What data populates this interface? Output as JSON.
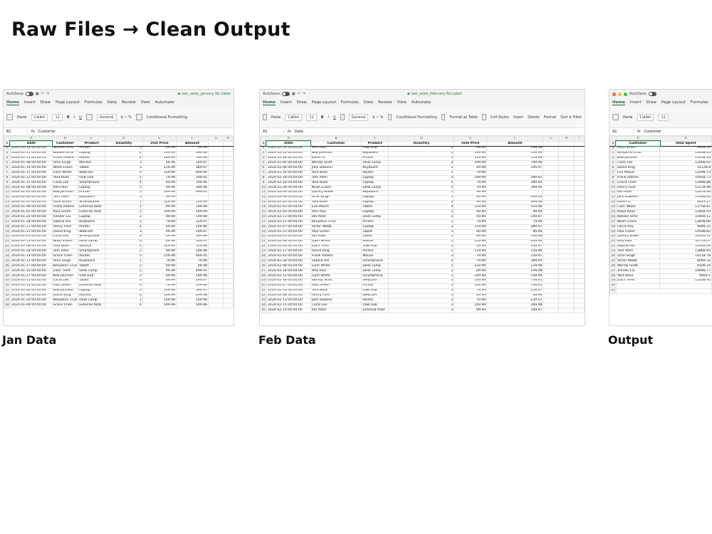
{
  "title": "Raw Files → Clean Output",
  "common": {
    "autosave": "AutoSave",
    "tabs": [
      "Home",
      "Insert",
      "Draw",
      "Page Layout",
      "Formulas",
      "Data",
      "Review",
      "View",
      "Automate"
    ],
    "font": "Calibri",
    "font_size": "11",
    "number_format": "General",
    "paste": "Paste",
    "cond_format": "Conditional Formatting",
    "format_table": "Format as Table",
    "cell_styles": "Cell Styles",
    "insert": "Insert",
    "delete": "Delete",
    "format": "Format",
    "sort_filter": "Sort & Filter",
    "fx": "fx",
    "no_label": "No Label"
  },
  "jan": {
    "caption": "Jan Data",
    "doc_name": "raw_sales_january",
    "cell_ref": "B1",
    "formula": "Customer",
    "col_letters": [
      "A",
      "B",
      "C",
      "D",
      "E",
      "F",
      "G",
      "H"
    ],
    "headers": [
      "Date",
      "Customer",
      "Product",
      "Quantity",
      "Unit Price",
      "Amount"
    ],
    "rows": [
      [
        "2024-01-14 00:00:00",
        "Natalie Ortiz",
        "Printer",
        "1",
        "49.99",
        "49.99"
      ],
      [
        "2024-01-21 00:00:00",
        "Natalie Ortiz",
        "Laptop",
        "4",
        "149.99",
        "599.96"
      ],
      [
        "2024-01-11 00:00:00",
        "Frank Adams",
        "Router",
        "4",
        "199.99",
        "799.96"
      ],
      [
        "2024-01-08 00:00:00",
        "Uma Singh",
        "Monitor",
        "3",
        "49.99",
        "149.97"
      ],
      [
        "2024-01-14 00:00:00",
        "Noah Evans",
        "Tablet",
        "3",
        "129.99",
        "389.97"
      ],
      [
        "2024-01-17 00:00:00",
        "Liam White",
        "Webcam",
        "5",
        "129.99",
        "649.95"
      ],
      [
        "2024-01-12 00:00:00",
        "Yara Bose",
        "USB Hub",
        "5",
        "79.99",
        "399.95"
      ],
      [
        "2024-01-15 00:00:00",
        "Carla Lee",
        "Smartphone",
        "4",
        "49.99",
        "199.96"
      ],
      [
        "2024-01-08 00:00:00",
        "Rita Paul",
        "Laptop",
        "5",
        "99.99",
        "399.96"
      ],
      [
        "2024-01-05 00:00:00",
        "Bob Johnson",
        "Printer",
        "5",
        "199.99",
        "999.95"
      ],
      [
        "2024-01-06 00:00:00",
        "Tom Allen",
        "Keyboard",
        "1",
        "99.99",
        ""
      ],
      [
        "2024-01-25 00:00:00",
        "Alice Smith",
        "Smartphone",
        "1",
        "129.99",
        "129.99"
      ],
      [
        "2024-01-09 00:00:00",
        "Frank Adams",
        "External HDD",
        "2",
        "99.99",
        "199.98"
      ],
      [
        "2024-01-03 00:00:00",
        "Paul Green",
        "External HDD",
        "1",
        "199.99",
        "199.99"
      ],
      [
        "2024-01-25 00:00:00",
        "Xander Liu",
        "Laptop",
        "2",
        "99.99",
        "199.98"
      ],
      [
        "2024-01-28 00:00:00",
        "Sophia Hill",
        "Keyboard",
        "3",
        "79.99",
        "239.97"
      ],
      [
        "2024-01-17 00:00:00",
        "Henry Ford",
        "Printer",
        "4",
        "49.99",
        "199.96"
      ],
      [
        "2024-01-21 00:00:00",
        "David King",
        "Webcam",
        "3",
        "99.99",
        "299.97"
      ],
      [
        "2024-01-23 00:00:00",
        "Carla Lee",
        "Smartphone",
        "4",
        "49.99",
        "199.96"
      ],
      [
        "2024-01-13 00:00:00",
        "Noah Evans",
        "Desk Lamp",
        "3",
        "49.99",
        "149.97"
      ],
      [
        "2024-01-08 00:00:00",
        "Yara Bose",
        "Monitor",
        "4",
        "129.99",
        "519.96"
      ],
      [
        "2024-01-28 00:00:00",
        "Tom Allen",
        "Smartphone",
        "2",
        "99.99",
        "199.98"
      ],
      [
        "2024-01-14 00:00:00",
        "Grace Chen",
        "Router",
        "5",
        "129.99",
        "649.95"
      ],
      [
        "2024-01-11 00:00:00",
        "Uma Singh",
        "Keyboard",
        "1",
        "79.99",
        "79.99"
      ],
      [
        "2024-01-27 00:00:00",
        "Benjamin Cruz",
        "Tablet",
        "2",
        "49.99",
        "99.98"
      ],
      [
        "2024-01-15 00:00:00",
        "Zach Trent",
        "Desk Lamp",
        "5",
        "99.99",
        "499.95"
      ],
      [
        "2024-01-27 00:00:00",
        "Bob Johnson",
        "USB Hub",
        "2",
        "99.99",
        "199.98"
      ],
      [
        "2024-01-11 00:00:00",
        "Carla Lee",
        "Tablet",
        "3",
        "99.99",
        "299.97"
      ],
      [
        "2024-01-14 00:00:00",
        "Paul Green",
        "External HDD",
        "4",
        "79.99",
        "319.96"
      ],
      [
        "2024-01-26 00:00:00",
        "Bob Johnson",
        "Laptop",
        "3",
        "199.99",
        "599.97"
      ],
      [
        "2024-01-28 00:00:00",
        "David King",
        "Monitor",
        "2",
        "149.99",
        "299.98"
      ],
      [
        "2024-01-20 00:00:00",
        "Benjamin Cruz",
        "Desk Lamp",
        "1",
        "149.99",
        "149.99"
      ],
      [
        "2024-01-09 00:00:00",
        "Grace Chen",
        "External HDD",
        "4",
        "149.99",
        "599.96"
      ]
    ]
  },
  "feb": {
    "caption": "Feb Data",
    "doc_name": "raw_sales_february",
    "cell_ref": "A1",
    "formula": "Date",
    "col_letters": [
      "A",
      "B",
      "C",
      "D",
      "E",
      "F",
      "G",
      "H",
      "I"
    ],
    "headers": [
      "Date",
      "Customer",
      "Product",
      "Quantity",
      "Unit Price",
      "Amount"
    ],
    "rows": [
      [
        "2024-02-19 00:00:00",
        "Rita Paul",
        "USB Hub",
        "2",
        "99.99",
        "199.98"
      ],
      [
        "2024-02-20 00:00:00",
        "Bob Johnson",
        "Keyboard",
        "1",
        "199.99",
        "199.99"
      ],
      [
        "2024-02-18 00:00:00",
        "Karen Li",
        "Printer",
        "4",
        "129.99",
        "519.96"
      ],
      [
        "2024-02-04 00:00:00",
        "Wendy Scott",
        "Desk Lamp",
        "4",
        "199.99",
        "799.96"
      ],
      [
        "2024-02-06 00:00:00",
        "Jack Dawson",
        "Keyboard",
        "3",
        "49.99",
        "149.97"
      ],
      [
        "2024-02-10 00:00:00",
        "Yara Bose",
        "Router",
        "1",
        "79.99",
        ""
      ],
      [
        "2024-02-18 00:00:00",
        "Tom Allen",
        "Laptop",
        "3",
        "199.99",
        "599.97"
      ],
      [
        "2024-02-20 00:00:00",
        "Yara Bose",
        "Laptop",
        "5",
        "79.99",
        "399.95"
      ],
      [
        "2024-02-28 00:00:00",
        "Noah Evans",
        "Desk Lamp",
        "5",
        "79.99",
        "399.95"
      ],
      [
        "2024-02-09 00:00:00",
        "Quincy Blake",
        "Keyboard",
        "1",
        "99.99",
        ""
      ],
      [
        "2024-02-06 00:00:00",
        "Uma Singh",
        "Laptop",
        "5",
        "99.99",
        "499.95"
      ],
      [
        "2024-02-20 00:00:00",
        "Yara Bose",
        "Laptop",
        "4",
        "99.99",
        "399.96"
      ],
      [
        "2024-02-03 00:00:00",
        "Eve Moore",
        "Tablet",
        "4",
        "129.99",
        "519.96"
      ],
      [
        "2024-02-03 00:00:00",
        "Rita Paul",
        "Laptop",
        "1",
        "99.99",
        "99.99"
      ],
      [
        "2024-02-11 00:00:00",
        "Ida Patel",
        "Desk Lamp",
        "3",
        "49.99",
        "149.97"
      ],
      [
        "2024-02-21 00:00:00",
        "Benjamin Cruz",
        "Printer",
        "1",
        "79.99",
        "79.99"
      ],
      [
        "2024-02-07 00:00:00",
        "Victor Webb",
        "Laptop",
        "3",
        "129.99",
        "389.97"
      ],
      [
        "2024-02-25 00:00:00",
        "Paul Green",
        "Tablet",
        "1",
        "99.99",
        "99.99"
      ],
      [
        "2024-02-23 00:00:00",
        "Ida Patel",
        "Tablet",
        "2",
        "99.99",
        "199.98"
      ],
      [
        "2024-02-09 00:00:00",
        "Liam White",
        "Mouse",
        "5",
        "129.99",
        "649.95"
      ],
      [
        "2024-02-03 00:00:00",
        "Zach Trent",
        "USB Hub",
        "3",
        "49.99",
        "149.97"
      ],
      [
        "2024-02-11 00:00:00",
        "David King",
        "Printer",
        "1",
        "129.99",
        "129.99"
      ],
      [
        "2024-02-02 00:00:00",
        "Frank Adams",
        "Mouse",
        "3",
        "79.99",
        "239.97"
      ],
      [
        "2024-02-28 00:00:00",
        "Sophia Hill",
        "Smartphone",
        "5",
        "79.99",
        "399.95"
      ],
      [
        "2024-02-06 00:00:00",
        "Liam White",
        "Desk Lamp",
        "1",
        "129.99",
        "129.99"
      ],
      [
        "2024-02-18 00:00:00",
        "Rita Paul",
        "Desk Lamp",
        "2",
        "99.99",
        "199.98"
      ],
      [
        "2024-02-13 00:00:00",
        "Liam White",
        "Smartphone",
        "1",
        "149.99",
        "149.99"
      ],
      [
        "2024-02-18 00:00:00",
        "Wendy Scott",
        "Webcam",
        "5",
        "149.99",
        "749.95"
      ],
      [
        "2024-02-27 00:00:00",
        "Paul Green",
        "Printer",
        "5",
        "149.99",
        "749.95"
      ],
      [
        "2024-02-13 00:00:00",
        "Yara Bose",
        "USB Hub",
        "3",
        "79.99",
        "239.97"
      ],
      [
        "2024-02-08 00:00:00",
        "Henry Ford",
        "Webcam",
        "1",
        "49.99",
        "49.99"
      ],
      [
        "2024-02-13 00:00:00",
        "Jack Dawson",
        "Router",
        "3",
        "79.99",
        "239.97"
      ],
      [
        "2024-02-15 00:00:00",
        "Carla Lee",
        "USB Hub",
        "2",
        "149.99",
        "299.98"
      ],
      [
        "2024-02-10 00:00:00",
        "Ida Patel",
        "External HDD",
        "3",
        "99.99",
        "299.97"
      ]
    ]
  },
  "out": {
    "caption": "Output",
    "cell_ref": "A1",
    "formula": "Customer",
    "col_letters": [
      "A",
      "B"
    ],
    "headers": [
      "Customer",
      "Total Spent"
    ],
    "rows": [
      [
        "Alice Smith",
        "9909.19"
      ],
      [
        "Benjamin Cruz",
        "15618.63"
      ],
      [
        "Bob Johnson",
        "13458.93"
      ],
      [
        "Carla Lee",
        "13068.93"
      ],
      [
        "David King",
        "14128.8"
      ],
      [
        "Eve Moore",
        "12008.73"
      ],
      [
        "Frank Adams",
        "14958.73"
      ],
      [
        "Grace Chen",
        "12898.88"
      ],
      [
        "Henry Ford",
        "12278.98"
      ],
      [
        "Ida Patel",
        "12678.94"
      ],
      [
        "Jack Dawson",
        "11908.94"
      ],
      [
        "Karen Li",
        "8919.27"
      ],
      [
        "Liam White",
        "13758.87"
      ],
      [
        "Maya Khan",
        "12858.93"
      ],
      [
        "Natalie Ortiz",
        "10469.11"
      ],
      [
        "Noah Evans",
        "13608.86"
      ],
      [
        "Olivia Ray",
        "9089.35"
      ],
      [
        "Paul Green",
        "14598.82"
      ],
      [
        "Quincy Blake",
        "10209.12"
      ],
      [
        "Rita Paul",
        "10719.07"
      ],
      [
        "Sophia Hill",
        "10399.09"
      ],
      [
        "Tom Allen",
        "13868.95"
      ],
      [
        "Uma Singh",
        "14218.78"
      ],
      [
        "Victor Webb",
        "8069.33"
      ],
      [
        "Wendy Scott",
        "9309.24"
      ],
      [
        "Xander Liu",
        "14998.77"
      ],
      [
        "Yara Bose",
        "9469.1"
      ],
      [
        "Zach Trent",
        "12008.95"
      ],
      [
        "",
        ""
      ],
      [
        "",
        ""
      ]
    ]
  }
}
